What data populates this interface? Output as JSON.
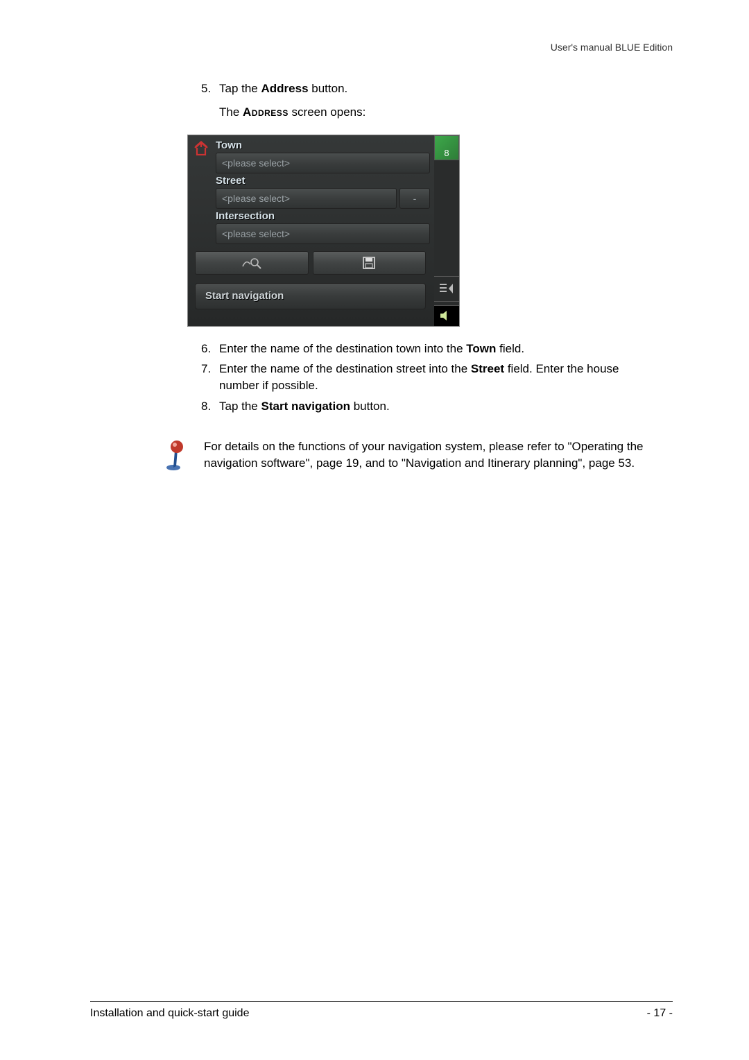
{
  "header": {
    "right": "User's manual BLUE Edition"
  },
  "steps": {
    "s5": {
      "num": "5.",
      "text_a": "Tap the ",
      "bold": "Address",
      "text_b": " button."
    },
    "sub5": {
      "text_a": "The ",
      "smallcaps": "Address",
      "text_b": " screen opens:"
    },
    "s6": {
      "num": "6.",
      "text_a": "Enter the name of the destination town into the ",
      "bold": "Town",
      "text_b": " field."
    },
    "s7": {
      "num": "7.",
      "text_a": "Enter the name of the destination street into the ",
      "bold": "Street",
      "text_b": " field. Enter the house number if possible."
    },
    "s8": {
      "num": "8.",
      "text_a": "Tap the ",
      "bold": "Start navigation",
      "text_b": " button."
    }
  },
  "screenshot": {
    "sat_count": "8",
    "town_label": "Town",
    "town_placeholder": "<please select>",
    "street_label": "Street",
    "street_placeholder": "<please select>",
    "street_num_placeholder": "-",
    "intersection_label": "Intersection",
    "intersection_placeholder": "<please select>",
    "start_navigation": "Start navigation"
  },
  "info": {
    "text": "For details on the functions of your navigation system, please refer to \"Operating the navigation software\", page 19, and to \"Navigation and Itinerary planning\", page 53."
  },
  "footer": {
    "left": "Installation and quick-start guide",
    "right": "- 17 -"
  }
}
